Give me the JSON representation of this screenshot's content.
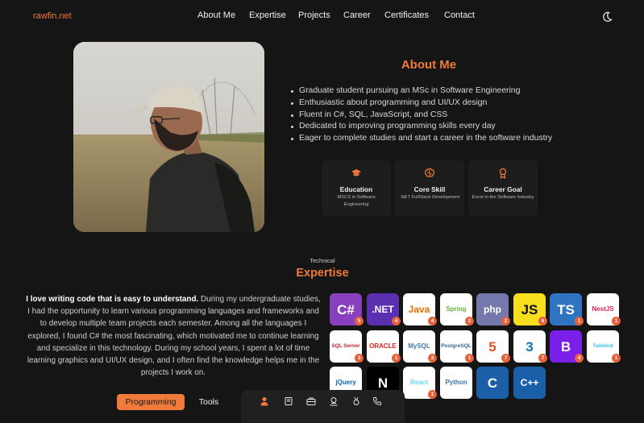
{
  "header": {
    "logo": "rawfin.net",
    "nav": [
      "About Me",
      "Expertise",
      "Projects",
      "Career",
      "Certificates",
      "Contact"
    ],
    "theme_toggle_icon": "moon-icon"
  },
  "about": {
    "title": "About Me",
    "bullets": [
      "Graduate student pursuing an MSc in Software Engineering",
      "Enthusiastic about programming and UI/UX design",
      "Fluent in C#, SQL, JavaScript, and CSS",
      "Dedicated to improving programming skills every day",
      "Eager to complete studies and start a career in the software industry"
    ],
    "cards": [
      {
        "icon": "graduation-cap-icon",
        "title": "Education",
        "text": "MSCS in Software Engineering"
      },
      {
        "icon": "brain-icon",
        "title": "Core Skill",
        "text": ".NET FullStack Development"
      },
      {
        "icon": "award-icon",
        "title": "Career Goal",
        "text": "Excel in the Software Industry"
      }
    ]
  },
  "expertise": {
    "kicker": "Technical",
    "title": "Expertise",
    "intro_bold": "I love writing code that is easy to understand.",
    "intro_rest": " During my undergraduate studies, I had the opportunity to learn various programming languages and frameworks and to develop multiple team projects each semester. Among all the languages I explored, I found C# the most fascinating, which motivated me to continue learning and specialize in this technology. During my school years, I spent a lot of time learning graphics and UI/UX design, and I often find the knowledge helps me in the projects I work on.",
    "tabs": [
      "Programming",
      "Tools"
    ],
    "skills": [
      {
        "label": "C#",
        "badge": "5",
        "bg": "#8a3fbf",
        "fg": "#ffffff"
      },
      {
        "label": ".NET",
        "badge": "4",
        "bg": "#5a2fb0",
        "fg": "#ffffff"
      },
      {
        "label": "Java",
        "badge": "4",
        "bg": "#ffffff",
        "fg": "#e76f00"
      },
      {
        "label": "Spring",
        "badge": "2",
        "bg": "#ffffff",
        "fg": "#6db33f"
      },
      {
        "label": "php",
        "badge": "2",
        "bg": "#7478ad",
        "fg": "#ffffff"
      },
      {
        "label": "JS",
        "badge": "6",
        "bg": "#f7df1e",
        "fg": "#111111"
      },
      {
        "label": "TS",
        "badge": "1",
        "bg": "#2f74c0",
        "fg": "#ffffff"
      },
      {
        "label": "NestJS",
        "badge": "1",
        "bg": "#ffffff",
        "fg": "#e0234e"
      },
      {
        "label": "SQL Server",
        "badge": "3",
        "bg": "#ffffff",
        "fg": "#c8262a"
      },
      {
        "label": "ORACLE",
        "badge": "1",
        "bg": "#ffffff",
        "fg": "#e2231a"
      },
      {
        "label": "MySQL",
        "badge": "3",
        "bg": "#ffffff",
        "fg": "#4479a1"
      },
      {
        "label": "PostgreSQL",
        "badge": "1",
        "bg": "#ffffff",
        "fg": "#336791"
      },
      {
        "label": "5",
        "badge": "7",
        "bg": "#ffffff",
        "fg": "#e34f26"
      },
      {
        "label": "3",
        "badge": "7",
        "bg": "#ffffff",
        "fg": "#1572b6"
      },
      {
        "label": "B",
        "badge": "4",
        "bg": "#7a1fea",
        "fg": "#ffffff"
      },
      {
        "label": "Tailwind",
        "badge": "1",
        "bg": "#ffffff",
        "fg": "#38bdf8"
      },
      {
        "label": "jQuery",
        "badge": "",
        "bg": "#ffffff",
        "fg": "#0865a6"
      },
      {
        "label": "N",
        "badge": "1",
        "bg": "#000000",
        "fg": "#ffffff"
      },
      {
        "label": "React",
        "badge": "1",
        "bg": "#ffffff",
        "fg": "#61dafb"
      },
      {
        "label": "Python",
        "badge": "",
        "bg": "#ffffff",
        "fg": "#3776ab"
      },
      {
        "label": "C",
        "badge": "",
        "bg": "#1b5fa8",
        "fg": "#ffffff"
      },
      {
        "label": "C++",
        "badge": "",
        "bg": "#1b5fa8",
        "fg": "#ffffff"
      }
    ]
  },
  "dock": {
    "icons": [
      "user-icon",
      "book-icon",
      "briefcase-icon",
      "career-icon",
      "medal-icon",
      "phone-icon"
    ]
  },
  "colors": {
    "accent": "#f07a3a",
    "background": "#151515",
    "card": "#1d1d1d",
    "badge": "#e8603a"
  }
}
